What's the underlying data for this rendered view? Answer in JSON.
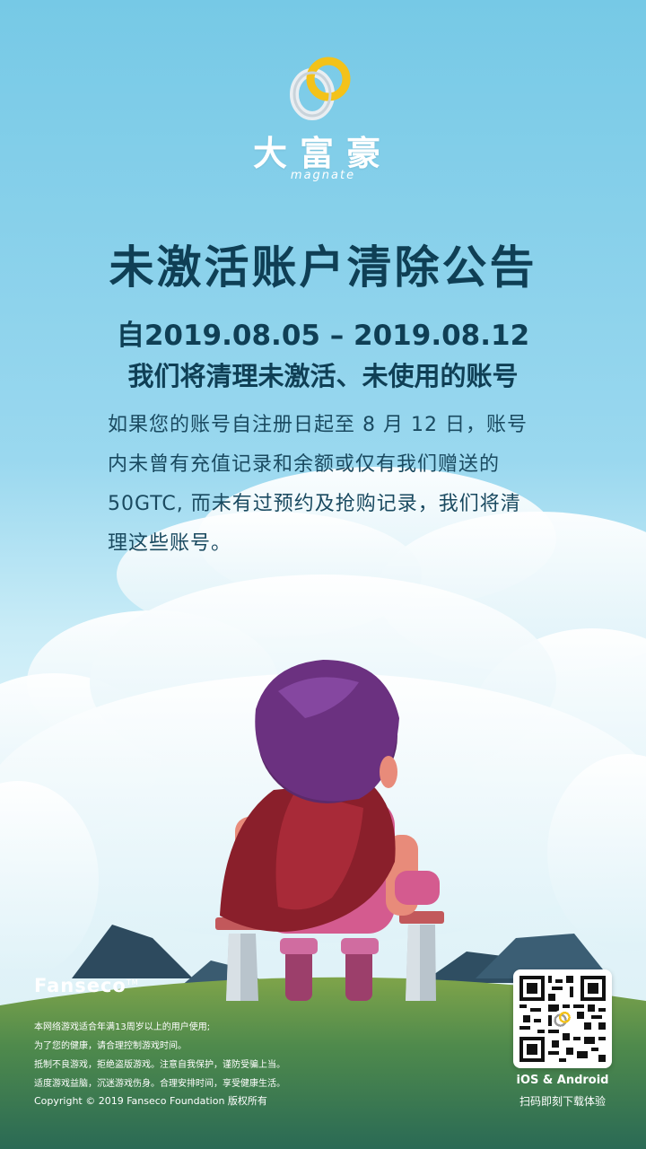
{
  "logo": {
    "title": "大富豪",
    "subtitle": "magnate"
  },
  "headline": "未激活账户清除公告",
  "date_range": "自2019.08.05 – 2019.08.12",
  "subhead": "我们将清理未激活、未使用的账号",
  "body_lines": [
    "如果您的账号自注册日起至 8 月 12 日，账号",
    "内未曾有充值记录和余额或仅有我们赠送的",
    "50GTC, 而未有过预约及抢购记录，我们将清",
    "理这些账号。"
  ],
  "footer": {
    "brand": "Fanseco",
    "trademark": "TM",
    "notice_lines": [
      "本网络游戏适合年满13周岁以上的用户使用;",
      "为了您的健康，请合理控制游戏时间。",
      "抵制不良游戏，拒绝盗版游戏。注意自我保护，谨防受骗上当。",
      "适度游戏益脑，沉迷游戏伤身。合理安排时间，享受健康生活。"
    ],
    "copyright": "Copyright © 2019 Fanseco Foundation 版权所有",
    "platforms": "iOS & Android",
    "download_cta": "扫码即刻下载体验"
  },
  "colors": {
    "sky": "#76c9e6",
    "heading": "#0f3f55",
    "grass": "#3f7a4a",
    "hair": "#5c2a6b",
    "cape": "#8a1f2b"
  },
  "icons": [
    "logo-ring-icon",
    "qr-code-icon"
  ]
}
